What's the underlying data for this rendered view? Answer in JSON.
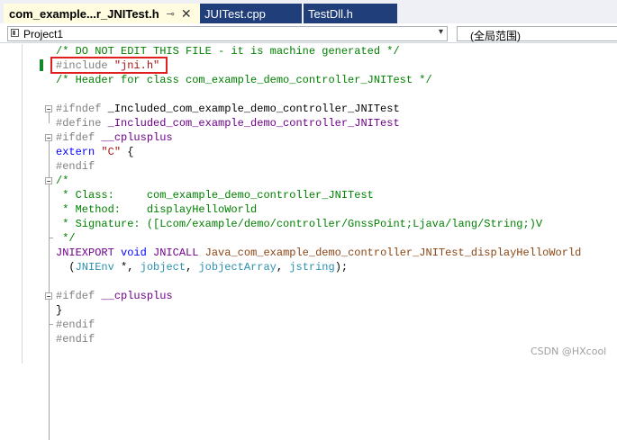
{
  "tabs": [
    {
      "label": "com_example...r_JNITest.h",
      "active": true,
      "pin_glyph": "⊸",
      "close_glyph": "✕"
    },
    {
      "label": "JUITest.cpp",
      "active": false
    },
    {
      "label": "TestDll.h",
      "active": false
    }
  ],
  "navbar": {
    "project": "Project1",
    "scope": "(全局范围)"
  },
  "code": {
    "lines": [
      [
        {
          "t": "/* DO NOT EDIT THIS FILE - it is machine generated */",
          "c": "comment"
        }
      ],
      [
        {
          "t": "#include ",
          "c": "pre"
        },
        {
          "t": "\"jni.h\"",
          "c": "str"
        }
      ],
      [
        {
          "t": "/* Header for class com_example_demo_controller_JNITest */",
          "c": "comment"
        }
      ],
      [],
      [
        {
          "t": "#ifndef ",
          "c": "pre"
        },
        {
          "t": "_Included_com_example_demo_controller_JNITest",
          "c": "text"
        }
      ],
      [
        {
          "t": "#define ",
          "c": "pre"
        },
        {
          "t": "_Included_com_example_demo_controller_JNITest",
          "c": "macro"
        }
      ],
      [
        {
          "t": "#ifdef ",
          "c": "pre"
        },
        {
          "t": "__cplusplus",
          "c": "macro"
        }
      ],
      [
        {
          "t": "extern ",
          "c": "kw"
        },
        {
          "t": "\"C\"",
          "c": "str"
        },
        {
          "t": " {",
          "c": "punct"
        }
      ],
      [
        {
          "t": "#endif",
          "c": "pre"
        }
      ],
      [
        {
          "t": "/*",
          "c": "comment"
        }
      ],
      [
        {
          "t": " * Class:     com_example_demo_controller_JNITest",
          "c": "comment"
        }
      ],
      [
        {
          "t": " * Method:    displayHelloWorld",
          "c": "comment"
        }
      ],
      [
        {
          "t": " * Signature: ([Lcom/example/demo/controller/GnssPoint;Ljava/lang/String;)V",
          "c": "comment"
        }
      ],
      [
        {
          "t": " */",
          "c": "comment"
        }
      ],
      [
        {
          "t": "JNIEXPORT",
          "c": "macro"
        },
        {
          "t": " void ",
          "c": "kw"
        },
        {
          "t": "JNICALL",
          "c": "macro"
        },
        {
          "t": " Java_com_example_demo_controller_JNITest_displayHelloWorld",
          "c": "brown"
        }
      ],
      [
        {
          "t": "  (",
          "c": "punct"
        },
        {
          "t": "JNIEnv",
          "c": "type"
        },
        {
          "t": " *, ",
          "c": "punct"
        },
        {
          "t": "jobject",
          "c": "type"
        },
        {
          "t": ", ",
          "c": "punct"
        },
        {
          "t": "jobjectArray",
          "c": "type"
        },
        {
          "t": ", ",
          "c": "punct"
        },
        {
          "t": "jstring",
          "c": "type"
        },
        {
          "t": ");",
          "c": "punct"
        }
      ],
      [],
      [
        {
          "t": "#ifdef ",
          "c": "pre"
        },
        {
          "t": "__cplusplus",
          "c": "macro"
        }
      ],
      [
        {
          "t": "}",
          "c": "punct"
        }
      ],
      [
        {
          "t": "#endif",
          "c": "pre"
        }
      ],
      [
        {
          "t": "#endif",
          "c": "pre"
        }
      ]
    ]
  },
  "watermark": "CSDN @HXcool",
  "colors": {
    "tab_active_bg": "#fffce0",
    "tab_inactive_bg": "#1f3e7a",
    "comment": "#008000",
    "preprocessor": "#808080",
    "string": "#a31515",
    "keyword": "#0000ff",
    "macro": "#6f008a",
    "type": "#2b91af",
    "highlight_box": "#e02020",
    "change_bar": "#108a2c"
  },
  "icons": {
    "project": "vc-project-icon",
    "dropdown": "chevron-down-icon",
    "pin": "pin-icon",
    "close": "close-icon",
    "fold": "fold-collapse-icon"
  }
}
